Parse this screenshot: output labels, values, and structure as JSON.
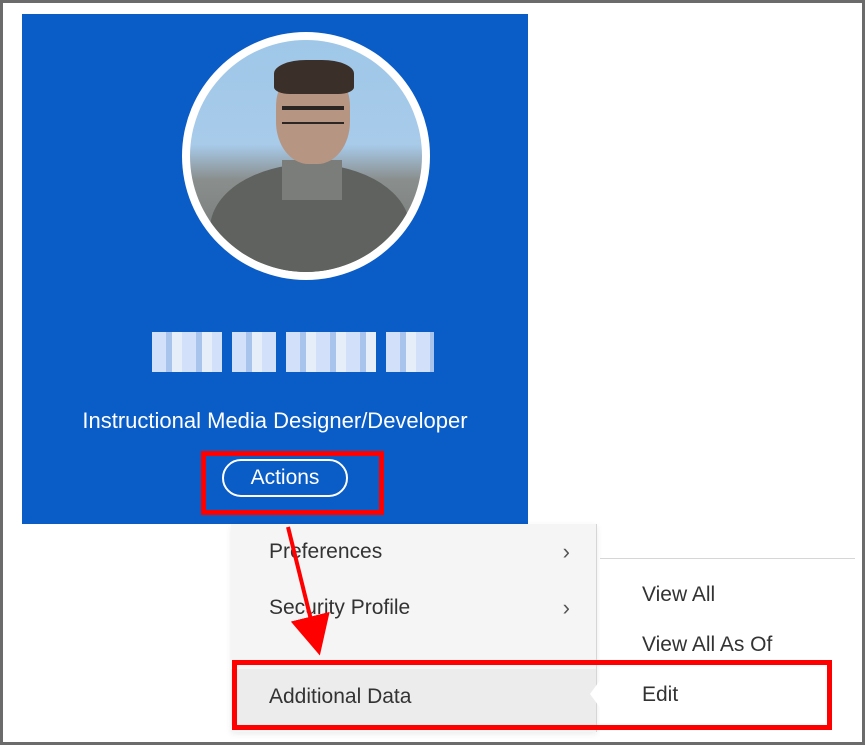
{
  "profile": {
    "job_title": "Instructional Media Designer/Developer",
    "actions_label": "Actions"
  },
  "menu": {
    "items": [
      {
        "label": "Preferences",
        "has_submenu": true
      },
      {
        "label": "Security Profile",
        "has_submenu": true
      },
      {
        "label": "Additional Data",
        "has_submenu": true
      }
    ]
  },
  "submenu": {
    "items": [
      {
        "label": "View All"
      },
      {
        "label": "View All As Of"
      },
      {
        "label": "Edit"
      }
    ]
  },
  "icons": {
    "chevron": "chevron-right-icon"
  },
  "colors": {
    "card_blue": "#0a5cc7",
    "highlight_red": "#ff0000"
  }
}
